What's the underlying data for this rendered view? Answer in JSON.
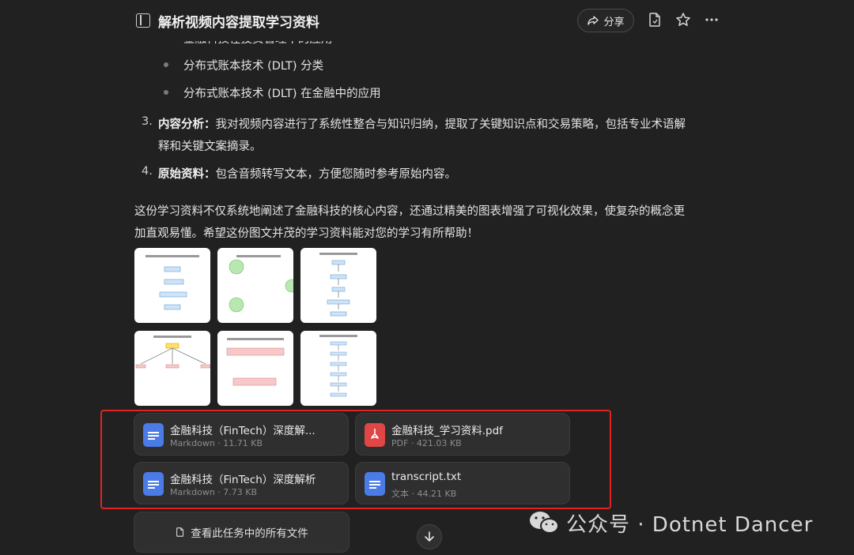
{
  "header": {
    "title": "解析视频内容提取学习资料",
    "share_label": "分享"
  },
  "bullets": [
    "金融科技在投资管理中的应用",
    "分布式账本技术 (DLT) 分类",
    "分布式账本技术 (DLT) 在金融中的应用"
  ],
  "list": [
    {
      "num": "3.",
      "term": "内容分析",
      "sep": "：",
      "line1": "我对视频内容进行了系统性整合与知识归纳，提取了关键知识点和交易策略，包括专业术语解",
      "line2": "释和关键文案摘录。"
    },
    {
      "num": "4.",
      "term": "原始资料",
      "sep": "：",
      "line1": "包含音频转写文本，方便您随时参考原始内容。"
    }
  ],
  "summary": {
    "line1": "这份学习资料不仅系统地阐述了金融科技的核心内容，还通过精美的图表增强了可视化效果，使复杂的概念更",
    "line2": "加直观易懂。希望这份图文并茂的学习资料能对您的学习有所帮助！"
  },
  "files": [
    {
      "name": "金融科技（FinTech）深度解...",
      "meta": "Markdown · 11.71 KB",
      "icon": "doc-icon",
      "color": "#4a7be6"
    },
    {
      "name": "金融科技_学习资料.pdf",
      "meta": "PDF · 421.03 KB",
      "icon": "pdf-icon",
      "color": "#e04646"
    },
    {
      "name": "金融科技（FinTech）深度解析",
      "meta": "Markdown · 7.73 KB",
      "icon": "doc-icon",
      "color": "#4a7be6"
    },
    {
      "name": "transcript.txt",
      "meta": "文本 · 44.21 KB",
      "icon": "doc-icon",
      "color": "#4a7be6"
    }
  ],
  "all_files_label": "查看此任务中的所有文件",
  "watermark_text": "公众号 · Dotnet Dancer",
  "colors": {
    "background": "#212121",
    "card": "#2f2f2f",
    "highlight": "#e02424"
  }
}
